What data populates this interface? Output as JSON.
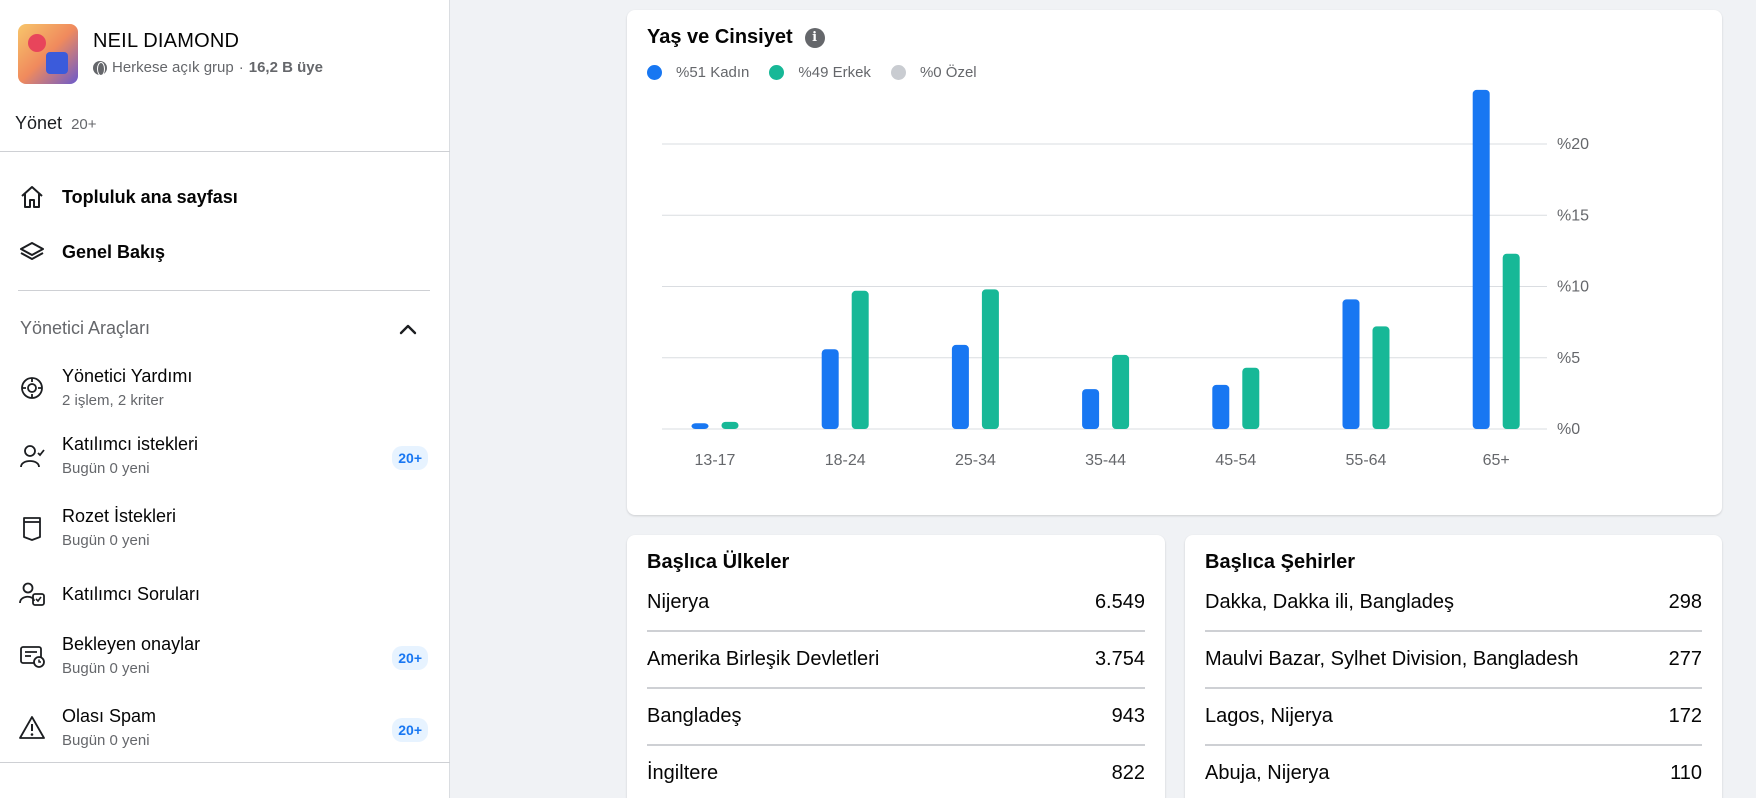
{
  "group": {
    "name": "NEIL DIAMOND",
    "privacy": "Herkese açık grup",
    "separator": "·",
    "members": "16,2 B üye"
  },
  "manage": {
    "label": "Yönet",
    "count": "20+"
  },
  "nav": [
    {
      "label": "Topluluk ana sayfası",
      "icon": "home-icon"
    },
    {
      "label": "Genel Bakış",
      "icon": "layers-icon"
    }
  ],
  "admin_tools": {
    "title": "Yönetici Araçları",
    "items": [
      {
        "title": "Yönetici Yardımı",
        "subtitle": "2 işlem, 2 kriter",
        "badge": "",
        "icon": "admin-assist-icon"
      },
      {
        "title": "Katılımcı istekleri",
        "subtitle": "Bugün 0 yeni",
        "badge": "20+",
        "icon": "member-requests-icon"
      },
      {
        "title": "Rozet İstekleri",
        "subtitle": "Bugün 0 yeni",
        "badge": "",
        "icon": "badge-icon"
      },
      {
        "title": "Katılımcı Soruları",
        "subtitle": "",
        "badge": "",
        "icon": "member-questions-icon"
      },
      {
        "title": "Bekleyen onaylar",
        "subtitle": "Bugün 0 yeni",
        "badge": "20+",
        "icon": "pending-approvals-icon"
      },
      {
        "title": "Olası Spam",
        "subtitle": "Bugün 0 yeni",
        "badge": "20+",
        "icon": "warning-icon"
      }
    ]
  },
  "chart_card": {
    "title": "Yaş ve Cinsiyet",
    "legend": [
      {
        "label": "%51 Kadın",
        "color": "#1877f2"
      },
      {
        "label": "%49 Erkek",
        "color": "#17b897"
      },
      {
        "label": "%0 Özel",
        "color": "#c9ccd1"
      }
    ]
  },
  "chart_data": {
    "type": "bar",
    "title": "Yaş ve Cinsiyet",
    "categories": [
      "13-17",
      "18-24",
      "25-34",
      "35-44",
      "45-54",
      "55-64",
      "65+"
    ],
    "series": [
      {
        "name": "%51 Kadın",
        "color": "#1877f2",
        "values": [
          0.4,
          5.6,
          5.9,
          2.8,
          3.1,
          9.1,
          23.8
        ]
      },
      {
        "name": "%49 Erkek",
        "color": "#17b897",
        "values": [
          0.5,
          9.7,
          9.8,
          5.2,
          4.3,
          7.2,
          12.3
        ]
      }
    ],
    "yticks": [
      0,
      5,
      10,
      15,
      20
    ],
    "ytick_labels": [
      "%0",
      "%5",
      "%10",
      "%15",
      "%20"
    ],
    "ylim": [
      0,
      24
    ],
    "grid": true,
    "y_axis_side": "right"
  },
  "countries": {
    "title": "Başlıca Ülkeler",
    "rows": [
      {
        "name": "Nijerya",
        "value": "6.549"
      },
      {
        "name": "Amerika Birleşik Devletleri",
        "value": "3.754"
      },
      {
        "name": "Bangladeş",
        "value": "943"
      },
      {
        "name": "İngiltere",
        "value": "822"
      }
    ]
  },
  "cities": {
    "title": "Başlıca Şehirler",
    "rows": [
      {
        "name": "Dakka, Dakka ili, Bangladeş",
        "value": "298"
      },
      {
        "name": "Maulvi Bazar, Sylhet Division, Bangladesh",
        "value": "277"
      },
      {
        "name": "Lagos, Nijerya",
        "value": "172"
      },
      {
        "name": "Abuja, Nijerya",
        "value": "110"
      }
    ]
  }
}
